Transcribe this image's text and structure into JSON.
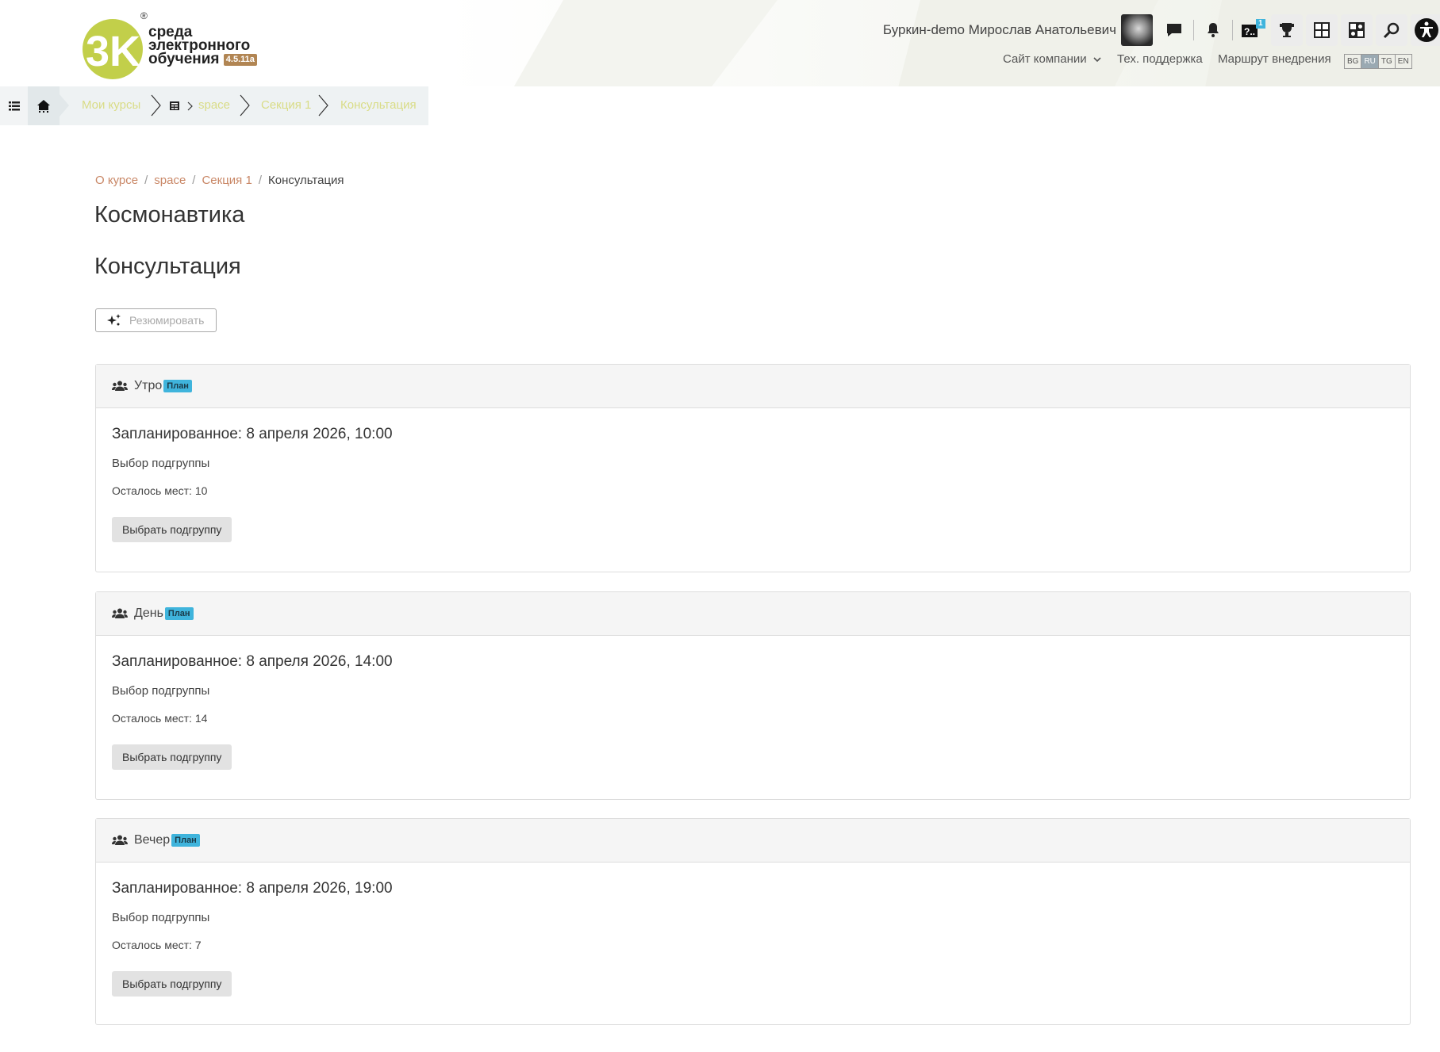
{
  "header": {
    "logo": {
      "line1": "среда",
      "line2": "электронного",
      "line3": "обучения",
      "version": "4.5.11a",
      "reg": "®",
      "mark": "3K"
    },
    "user_name": "Буркин-demo Мирослав Анатольевич",
    "icons": [
      "message-icon",
      "bell-icon",
      "help-icon",
      "trophy-icon",
      "dashboard-icon",
      "grid-icon",
      "search-icon",
      "accessibility-icon"
    ],
    "help_badge": "1",
    "links": {
      "company_site": "Сайт компании",
      "tech_support": "Тех. поддержка",
      "route": "Маршрут внедрения"
    },
    "languages": [
      {
        "code": "BG",
        "active": false
      },
      {
        "code": "RU",
        "active": true
      },
      {
        "code": "TG",
        "active": false
      },
      {
        "code": "EN",
        "active": false
      }
    ]
  },
  "crumbbar": {
    "my_courses": "Мои курсы",
    "space": "space",
    "section": "Секция 1",
    "consultation": "Консультация"
  },
  "breadcrumb": {
    "about": "О курсе",
    "space": "space",
    "section": "Секция 1",
    "current": "Консультация"
  },
  "course_title": "Космонавтика",
  "page_title": "Консультация",
  "summarize_label": "Резюмировать",
  "groups": [
    {
      "name": "Утро",
      "badge": "План",
      "scheduled": "Запланированное: 8 апреля 2026, 10:00",
      "choose_text": "Выбор подгруппы",
      "seats": "Осталось мест: 10",
      "button": "Выбрать подгруппу"
    },
    {
      "name": "День",
      "badge": "План",
      "scheduled": "Запланированное: 8 апреля 2026, 14:00",
      "choose_text": "Выбор подгруппы",
      "seats": "Осталось мест: 14",
      "button": "Выбрать подгруппу"
    },
    {
      "name": "Вечер",
      "badge": "План",
      "scheduled": "Запланированное: 8 апреля 2026, 19:00",
      "choose_text": "Выбор подгруппы",
      "seats": "Осталось мест: 7",
      "button": "Выбрать подгруппу"
    }
  ],
  "colors": {
    "accent_link": "#c98766",
    "crumb_text": "#d9dc86",
    "badge": "#3fb4dc",
    "logo_green": "#c2cf4a",
    "logo_version": "#b18553"
  }
}
